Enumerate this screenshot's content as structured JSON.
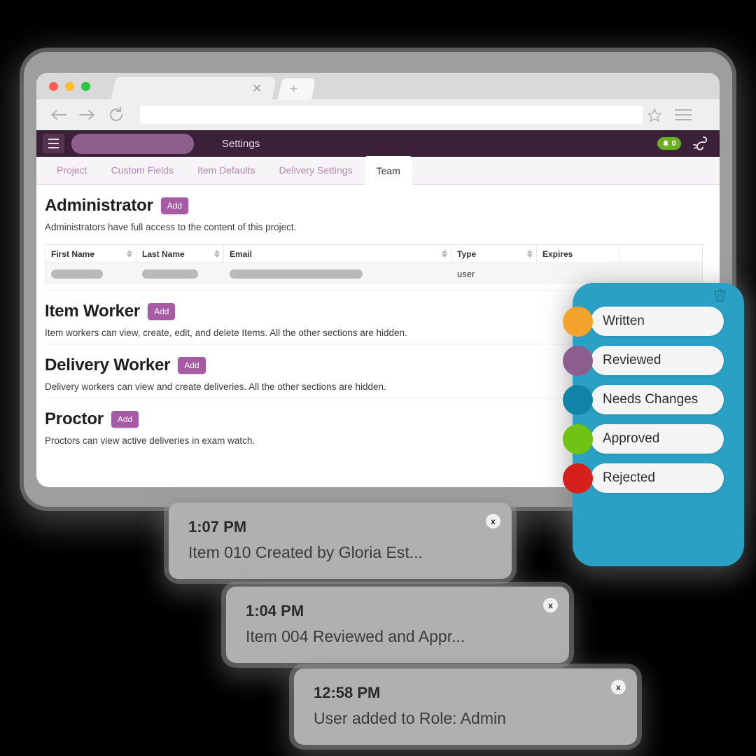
{
  "browser": {
    "tab_close_icon": "close-icon",
    "new_tab_icon": "plus-icon",
    "back_icon": "back-arrow-icon",
    "forward_icon": "forward-arrow-icon",
    "reload_icon": "reload-icon",
    "url_value": "",
    "url_placeholder": "",
    "bookmark_icon": "star-icon",
    "menu_icon": "hamburger-menu-icon"
  },
  "app_header": {
    "menu_icon": "hamburger-icon",
    "project_name": "",
    "title": "Settings",
    "notification_icon": "bell-icon",
    "notification_count": "0",
    "notification_color": "#6AB023",
    "logo_icon": "scorpion-logo-icon",
    "bar_color": "#3A2138",
    "project_pill_color": "#8E5E8C"
  },
  "tabs": [
    {
      "label": "Project",
      "active": false
    },
    {
      "label": "Custom Fields",
      "active": false
    },
    {
      "label": "Item Defaults",
      "active": false
    },
    {
      "label": "Delivery Settings",
      "active": false
    },
    {
      "label": "Team",
      "active": true
    }
  ],
  "sections": [
    {
      "title": "Administrator",
      "add_label": "Add",
      "description": "Administrators have full access to the content of this project.",
      "has_table": true
    },
    {
      "title": "Item Worker",
      "add_label": "Add",
      "description": "Item workers can view, create, edit, and delete Items. All the other sections are hidden.",
      "has_table": false
    },
    {
      "title": "Delivery Worker",
      "add_label": "Add",
      "description": "Delivery workers can view and create deliveries. All the other sections are hidden.",
      "has_table": false
    },
    {
      "title": "Proctor",
      "add_label": "Add",
      "description": "Proctors can view active deliveries in exam watch.",
      "has_table": false
    }
  ],
  "table": {
    "columns": [
      {
        "label": "First Name",
        "sortable": true
      },
      {
        "label": "Last Name",
        "sortable": true
      },
      {
        "label": "Email",
        "sortable": true
      },
      {
        "label": "Type",
        "sortable": true
      },
      {
        "label": "Expires",
        "sortable": false
      },
      {
        "label": "",
        "sortable": false
      }
    ],
    "rows": [
      {
        "first_name": "",
        "last_name": "",
        "email": "",
        "type": "user",
        "expires": "",
        "delete_icon": "trash-icon"
      }
    ]
  },
  "status_panel": {
    "background_color": "#2AA0C4",
    "trash_icon": "trash-icon",
    "statuses": [
      {
        "label": "Written",
        "color": "#F5A32A"
      },
      {
        "label": "Reviewed",
        "color": "#8B5E8E"
      },
      {
        "label": "Needs Changes",
        "color": "#1283A8"
      },
      {
        "label": "Approved",
        "color": "#70C213"
      },
      {
        "label": "Rejected",
        "color": "#D6201C"
      }
    ]
  },
  "toasts": [
    {
      "time": "1:07 PM",
      "message": "Item 010 Created by Gloria Est...",
      "close_label": "x"
    },
    {
      "time": "1:04 PM",
      "message": "Item 004 Reviewed and Appr...",
      "close_label": "x"
    },
    {
      "time": "12:58 PM",
      "message": "User added to Role: Admin",
      "close_label": "x"
    }
  ],
  "add_button_color": "#A75BA4"
}
